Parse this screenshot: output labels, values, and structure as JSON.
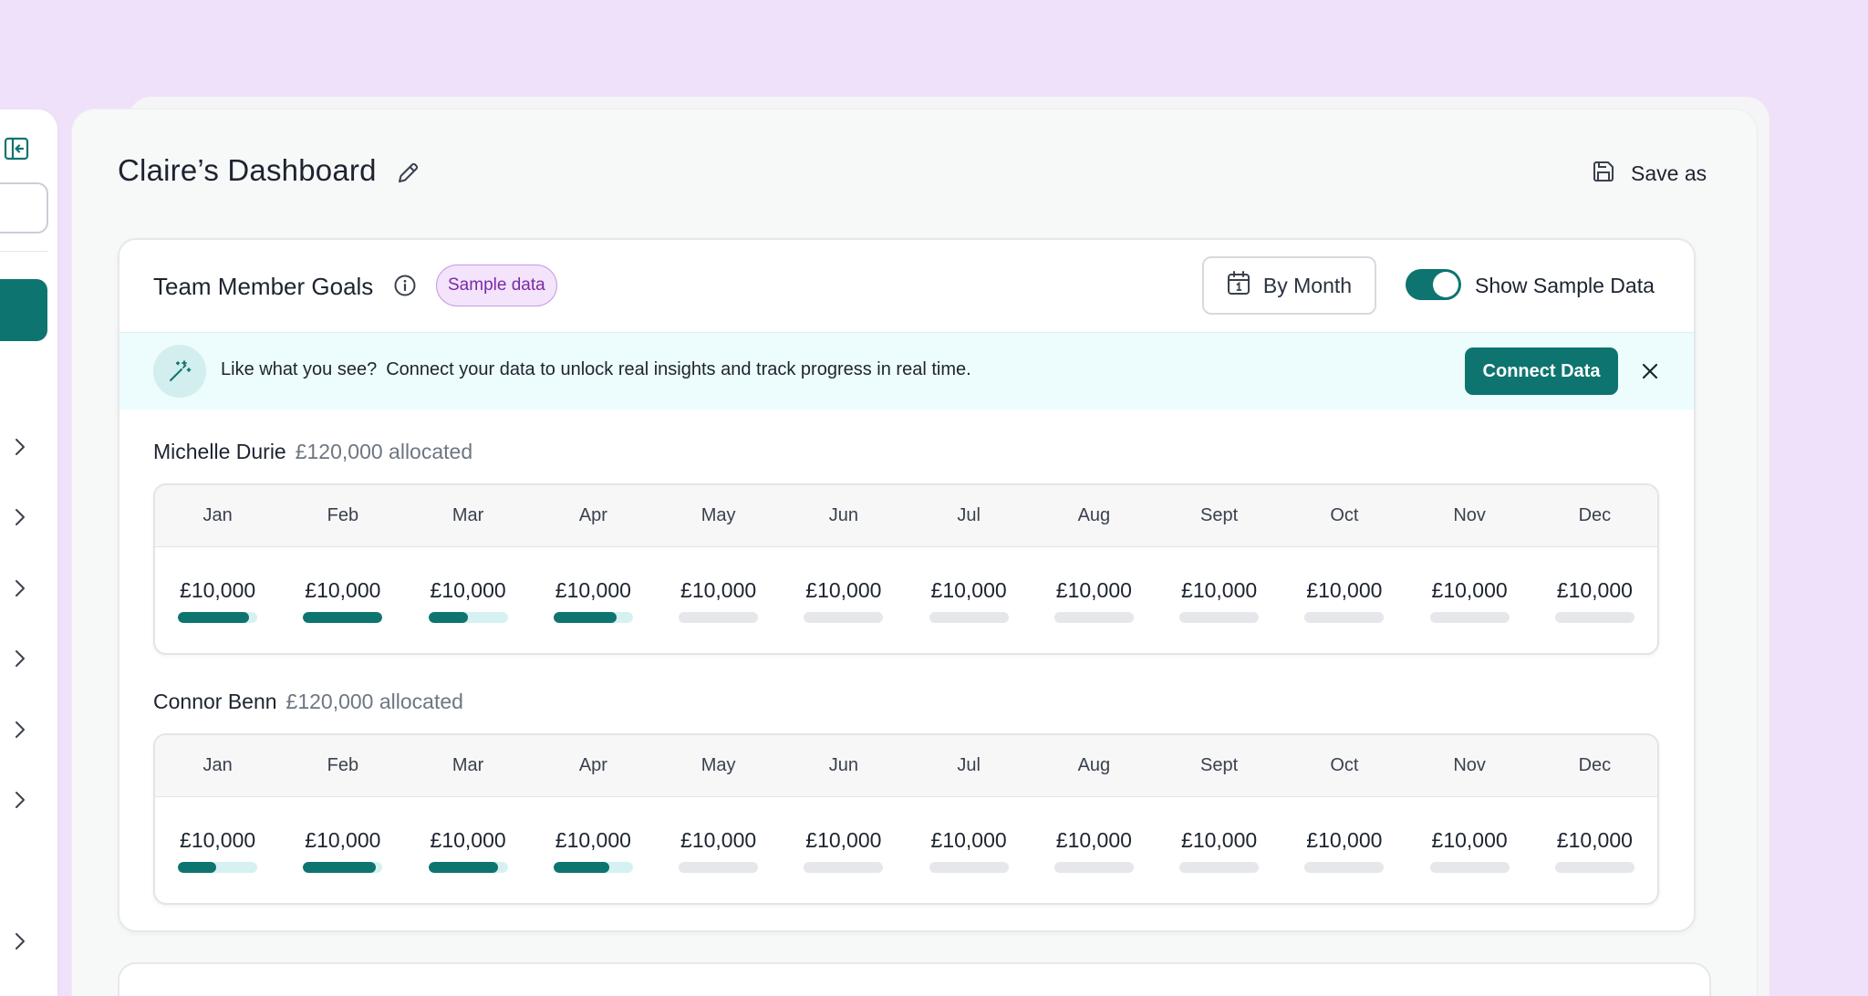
{
  "page": {
    "title": "Claire’s Dashboard",
    "save_as_label": "Save as"
  },
  "panel": {
    "title": "Team Member Goals",
    "badge": "Sample data",
    "period_button": "By Month",
    "toggle_label": "Show Sample Data",
    "toggle_on": true
  },
  "banner": {
    "lead": "Like what you see?",
    "text": "Connect your data to unlock real insights and track progress in real time.",
    "button": "Connect Data"
  },
  "months": [
    "Jan",
    "Feb",
    "Mar",
    "Apr",
    "May",
    "Jun",
    "Jul",
    "Aug",
    "Sept",
    "Oct",
    "Nov",
    "Dec"
  ],
  "members": [
    {
      "name": "Michelle Durie",
      "allocated": "£120,000 allocated",
      "values": [
        "£10,000",
        "£10,000",
        "£10,000",
        "£10,000",
        "£10,000",
        "£10,000",
        "£10,000",
        "£10,000",
        "£10,000",
        "£10,000",
        "£10,000",
        "£10,000"
      ],
      "progress": [
        0.9,
        1.0,
        0.5,
        0.8,
        0,
        0,
        0,
        0,
        0,
        0,
        0,
        0
      ]
    },
    {
      "name": "Connor Benn",
      "allocated": "£120,000 allocated",
      "values": [
        "£10,000",
        "£10,000",
        "£10,000",
        "£10,000",
        "£10,000",
        "£10,000",
        "£10,000",
        "£10,000",
        "£10,000",
        "£10,000",
        "£10,000",
        "£10,000"
      ],
      "progress": [
        0.48,
        0.92,
        0.88,
        0.7,
        0,
        0,
        0,
        0,
        0,
        0,
        0,
        0
      ]
    }
  ],
  "colors": {
    "accent": "#0e7470",
    "badge_text": "#7b2aa6",
    "background": "#efe1fa"
  }
}
